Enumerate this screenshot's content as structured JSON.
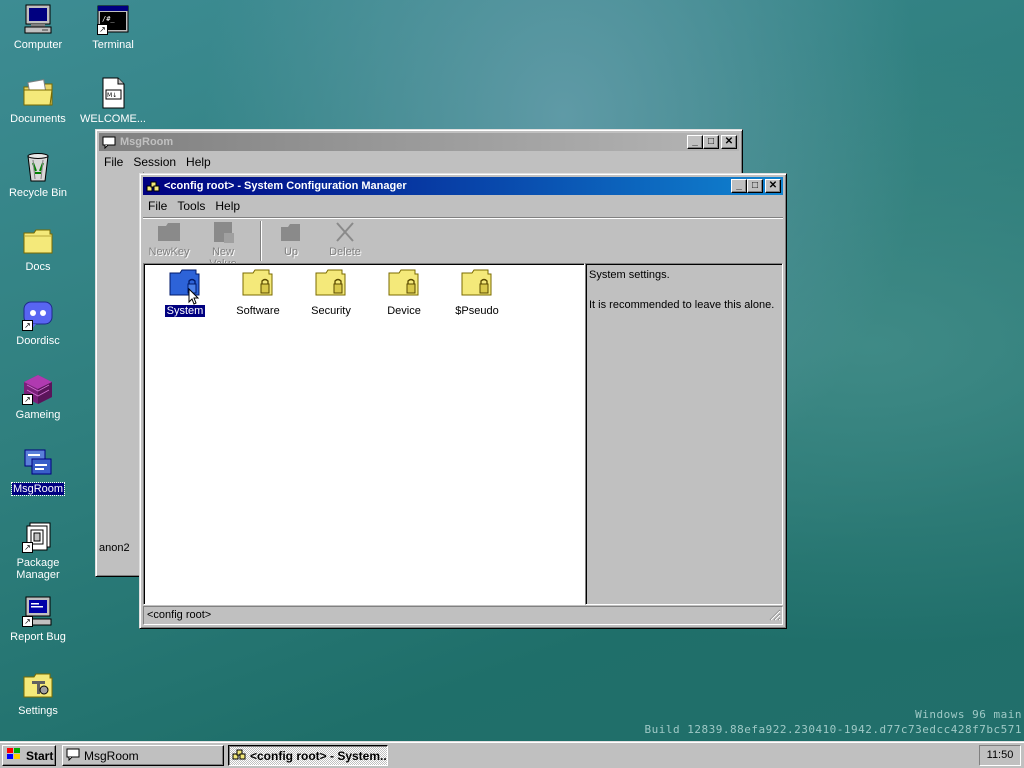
{
  "desktop": {
    "icons": [
      {
        "label": "Computer",
        "icon": "computer-icon"
      },
      {
        "label": "Terminal",
        "icon": "terminal-icon"
      },
      {
        "label": "Documents",
        "icon": "documents-folder-icon"
      },
      {
        "label": "WELCOME...",
        "icon": "markdown-file-icon"
      },
      {
        "label": "Recycle Bin",
        "icon": "recycle-bin-icon"
      },
      {
        "label": "Docs",
        "icon": "folder-icon"
      },
      {
        "label": "Doordisc",
        "icon": "discord-icon"
      },
      {
        "label": "Gameing",
        "icon": "purple-cube-icon"
      },
      {
        "label": "MsgRoom",
        "icon": "msgroom-icon"
      },
      {
        "label": "Package Manager",
        "icon": "package-icon"
      },
      {
        "label": "Report Bug",
        "icon": "report-bug-icon"
      },
      {
        "label": "Settings",
        "icon": "settings-icon"
      }
    ],
    "terminal_glyph": "/#_",
    "md_glyph": "M↓"
  },
  "msgroom_window": {
    "title": "MsgRoom",
    "menu": [
      "File",
      "Session",
      "Help"
    ],
    "user_text": "anon2"
  },
  "config_window": {
    "title": "<config root> - System Configuration Manager",
    "menu": [
      "File",
      "Tools",
      "Help"
    ],
    "toolbar": {
      "new_key": "NewKey",
      "new_value": "New Value",
      "up": "Up",
      "delete": "Delete"
    },
    "folders": [
      {
        "label": "System",
        "selected": true
      },
      {
        "label": "Software",
        "selected": false
      },
      {
        "label": "Security",
        "selected": false
      },
      {
        "label": "Device",
        "selected": false
      },
      {
        "label": "$Pseudo",
        "selected": false
      }
    ],
    "description": {
      "line1": "System settings.",
      "line2": "It is recommended to leave this alone."
    },
    "status": "<config root>"
  },
  "watermark": {
    "line1": "Windows 96 main",
    "line2": "Build 12839.88efa922.230410-1942.d77c73edcc428f7bc571"
  },
  "taskbar": {
    "start_label": "Start",
    "items": [
      "MsgRoom",
      "<config root> - System..."
    ],
    "clock": "11:50"
  },
  "colors": {
    "title_active_start": "#000080",
    "title_active_end": "#1084d0",
    "folder_yellow": "#f4e97a",
    "folder_selected_blue": "#2d63d8",
    "window_face": "#c0c0c0"
  }
}
